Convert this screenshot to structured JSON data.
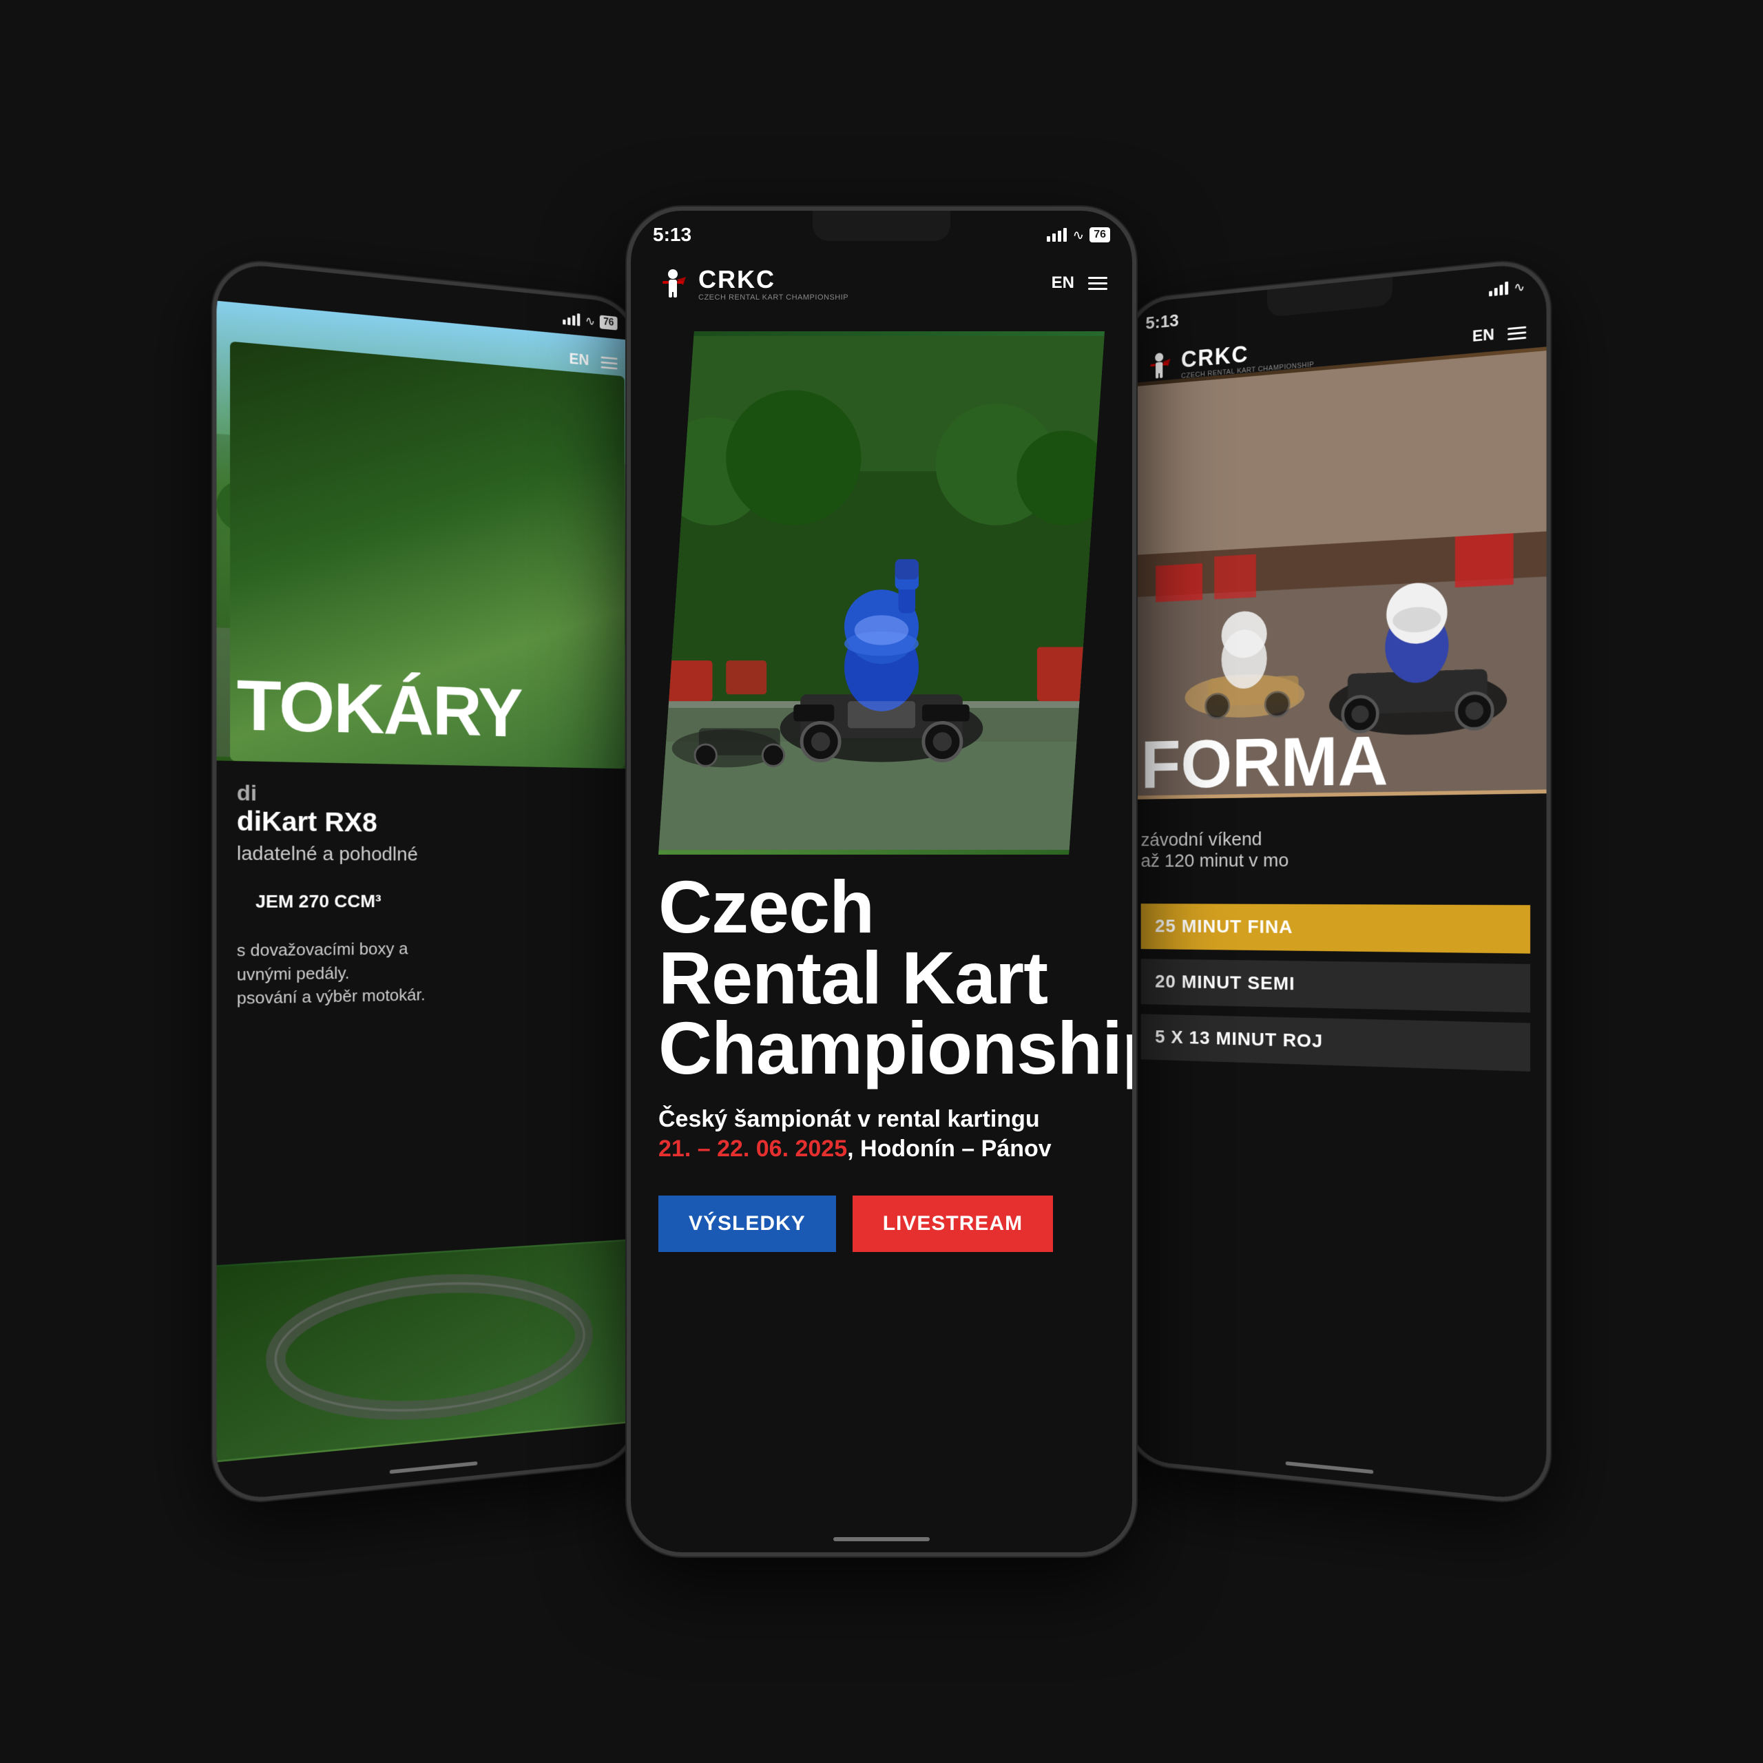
{
  "app": {
    "bg_color": "#111111"
  },
  "phones": {
    "left": {
      "status": {
        "time": "",
        "signal": "shown",
        "wifi": "shown",
        "battery": "76"
      },
      "nav": {
        "lang": "EN",
        "menu": "hamburger"
      },
      "hero": {
        "alt": "karting outdoor scene"
      },
      "big_title": "TOKÁRY",
      "product": {
        "name": "diKart RX8",
        "tagline": "ladatelné a pohodlné",
        "cta": "JEM 270 CCM³",
        "body1": "s dovažovacími boxy a",
        "body2": "uvnými pedály.",
        "body3": "psování a výběr motokár."
      }
    },
    "center": {
      "status": {
        "time": "5:13",
        "signal": "shown",
        "wifi": "shown",
        "battery": "76"
      },
      "nav": {
        "logo_text": "CRKC",
        "logo_subtitle": "CZECH RENTAL KART CHAMPIONSHIP",
        "lang": "EN",
        "menu": "hamburger"
      },
      "hero": {
        "alt": "kart racer celebrating victory"
      },
      "title_line1": "Czech",
      "title_line2": "Rental Kart",
      "title_line3": "Championship",
      "subtitle": "Český šampionát v rental kartingu",
      "date_red": "21. – 22. 06. 2025",
      "date_white": ", Hodonín – Pánov",
      "btn_results": "VÝSLEDKY",
      "btn_livestream": "LIVESTREAM"
    },
    "right": {
      "status": {
        "time": "5:13",
        "signal": "shown",
        "wifi": "shown",
        "battery": ""
      },
      "nav": {
        "logo_text": "CRKC",
        "logo_subtitle": "CZECH RENTAL KART CHAMPIONSHIP",
        "lang": "EN",
        "menu": "hamburger"
      },
      "hero": {
        "alt": "kart racing on track"
      },
      "big_title": "FORMA",
      "desc": "závodní víkend",
      "subdesc": "až 120 minut v mo",
      "race_options": [
        {
          "label": "25 MINUT FINA",
          "style": "gold"
        },
        {
          "label": "20 MINUT SEMI",
          "style": "dark"
        },
        {
          "label": "5 x 13 MINUT ROJ",
          "style": "dark"
        }
      ]
    }
  }
}
